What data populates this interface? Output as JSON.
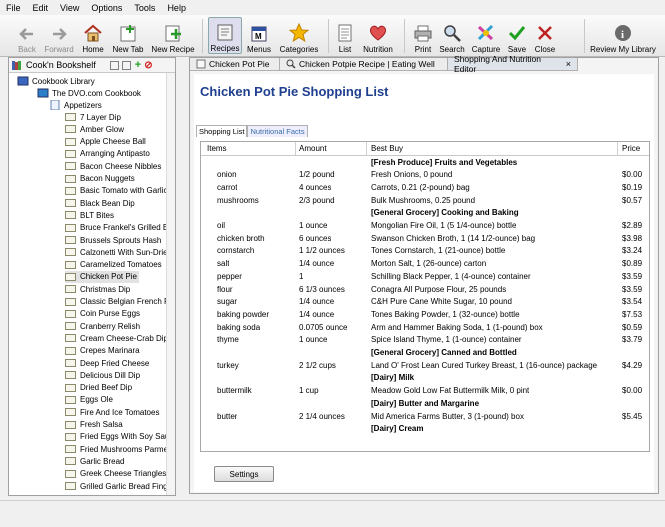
{
  "menu": [
    "File",
    "Edit",
    "View",
    "Options",
    "Tools",
    "Help"
  ],
  "toolbar": {
    "back": "Back",
    "forward": "Forward",
    "home": "Home",
    "new_tab": "New Tab",
    "new_recipe": "New Recipe",
    "recipes": "Recipes",
    "menus": "Menus",
    "categories": "Categories",
    "list": "List",
    "nutrition": "Nutrition",
    "print": "Print",
    "search": "Search",
    "capture": "Capture",
    "save": "Save",
    "close": "Close",
    "review": "Review My Library"
  },
  "bookshelf": {
    "title": "Cook'n Bookshelf"
  },
  "tree": {
    "library": "Cookbook Library",
    "cookbook": "The DVO.com Cookbook",
    "section": "Appetizers",
    "items": [
      "7 Layer Dip",
      "Amber Glow",
      "Apple Cheese Ball",
      "Arranging Antipasto",
      "Bacon Cheese Nibbles",
      "Bacon Nuggets",
      "Basic Tomato with Garlic",
      "Black Bean Dip",
      "BLT Bites",
      "Bruce Frankel's Grilled Bre",
      "Brussels Sprouts Hash",
      "Calzonetti With Sun-Dried",
      "Caramelized Tomatoes",
      "Chicken Pot Pie",
      "Christmas Dip",
      "Classic Belgian French Fri",
      "Coin Purse Eggs",
      "Cranberry Relish",
      "Cream Cheese-Crab Dip",
      "Crepes Marinara",
      "Deep Fried Cheese",
      "Delicious Dill Dip",
      "Dried Beef Dip",
      "Eggs Ole",
      "Fire And Ice Tomatoes",
      "Fresh Salsa",
      "Fried Eggs With Soy Sauce",
      "Fried Mushrooms Parmes",
      "Garlic Bread",
      "Greek Cheese Triangles",
      "Grilled Garlic Bread Fing"
    ]
  },
  "tabs": [
    "Chicken Pot Pie",
    "Chicken Potpie Recipe | Eating Well",
    "Shopping And Nutrition Editor"
  ],
  "page_title": "Chicken Pot Pie Shopping List",
  "subtabs": [
    "Shopping List",
    "Nutritional Facts"
  ],
  "columns": {
    "items": "Items",
    "amount": "Amount",
    "best_buy": "Best Buy",
    "price": "Price"
  },
  "rows": [
    {
      "cat": "[Fresh Produce] Fruits and Vegetables"
    },
    {
      "item": "onion",
      "amount": "1/2 pound",
      "buy": "Fresh Onions, 0 pound",
      "price": "$0.00"
    },
    {
      "item": "carrot",
      "amount": "4 ounces",
      "buy": "Carrots, 0.21 (2-pound) bag",
      "price": "$0.19"
    },
    {
      "item": "mushrooms",
      "amount": "2/3 pound",
      "buy": "Bulk Mushrooms, 0.25 pound",
      "price": "$0.57"
    },
    {
      "cat": "[General Grocery] Cooking and Baking"
    },
    {
      "item": "oil",
      "amount": "1 ounce",
      "buy": "Mongolian Fire Oil, 1 (5 1/4-ounce) bottle",
      "price": "$2.89"
    },
    {
      "item": "chicken broth",
      "amount": "6 ounces",
      "buy": "Swanson Chicken Broth, 1 (14 1/2-ounce) bag",
      "price": "$3.98"
    },
    {
      "item": "cornstarch",
      "amount": "1 1/2 ounces",
      "buy": "Tones Cornstarch, 1 (21-ounce) bottle",
      "price": "$3.24"
    },
    {
      "item": "salt",
      "amount": "1/4 ounce",
      "buy": "Morton Salt, 1 (26-ounce) carton",
      "price": "$0.89"
    },
    {
      "item": "pepper",
      "amount": "1",
      "buy": "Schilling Black Pepper, 1 (4-ounce) container",
      "price": "$3.59"
    },
    {
      "item": "flour",
      "amount": "6 1/3 ounces",
      "buy": "Conagra All Purpose Flour, 25 pounds",
      "price": "$3.59"
    },
    {
      "item": "sugar",
      "amount": "1/4 ounce",
      "buy": "C&H Pure Cane White Sugar, 10 pound",
      "price": "$3.54"
    },
    {
      "item": "baking powder",
      "amount": "1/4 ounce",
      "buy": "Tones Baking Powder, 1 (32-ounce) bottle",
      "price": "$7.53"
    },
    {
      "item": "baking soda",
      "amount": "0.0705 ounce",
      "buy": "Arm and Hammer Baking Soda, 1 (1-pound) box",
      "price": "$0.59"
    },
    {
      "item": "thyme",
      "amount": "1 ounce",
      "buy": "Spice Island Thyme, 1 (1-ounce) container",
      "price": "$3.79"
    },
    {
      "cat": "[General Grocery] Canned and Bottled"
    },
    {
      "item": "turkey",
      "amount": "2 1/2 cups",
      "buy": "Land O' Frost Lean Cured Turkey Breast, 1 (16-ounce) package",
      "price": "$4.29"
    },
    {
      "cat": "[Dairy] Milk"
    },
    {
      "item": "buttermilk",
      "amount": "1 cup",
      "buy": "Meadow Gold Low Fat Buttermilk Milk, 0 pint",
      "price": "$0.00"
    },
    {
      "cat": "[Dairy] Butter and Margarine"
    },
    {
      "item": "butter",
      "amount": "2 1/4 ounces",
      "buy": "Mid America Farms Butter, 3 (1-pound) box",
      "price": "$5.45"
    },
    {
      "cat": "[Dairy] Cream"
    }
  ],
  "settings_label": "Settings",
  "colors": {
    "title": "#1f3f8f",
    "accent": "#3a6ea5"
  }
}
